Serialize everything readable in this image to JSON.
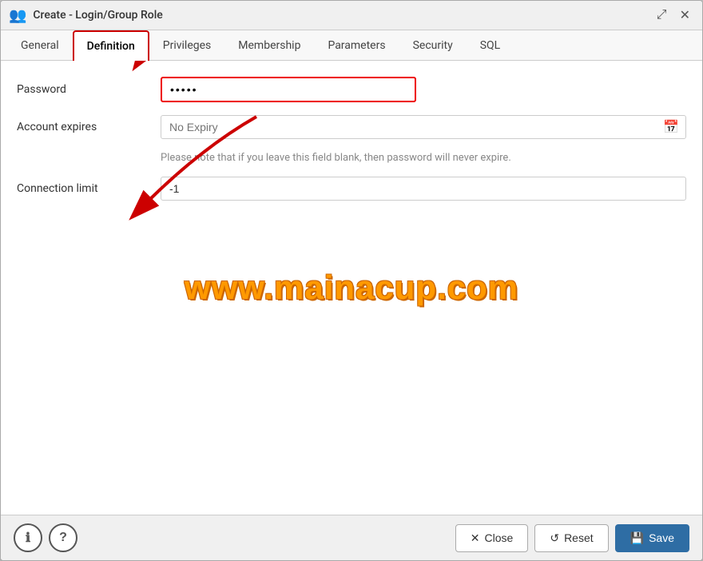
{
  "dialog": {
    "title": "Create - Login/Group Role",
    "maximize_label": "⤢",
    "close_label": "✕"
  },
  "tabs": [
    {
      "id": "general",
      "label": "General",
      "active": false
    },
    {
      "id": "definition",
      "label": "Definition",
      "active": true
    },
    {
      "id": "privileges",
      "label": "Privileges",
      "active": false
    },
    {
      "id": "membership",
      "label": "Membership",
      "active": false
    },
    {
      "id": "parameters",
      "label": "Parameters",
      "active": false
    },
    {
      "id": "security",
      "label": "Security",
      "active": false
    },
    {
      "id": "sql",
      "label": "SQL",
      "active": false
    }
  ],
  "form": {
    "password_label": "Password",
    "password_value": "•••••",
    "account_expires_label": "Account expires",
    "account_expires_placeholder": "No Expiry",
    "account_expires_hint": "Please note that if you leave this field blank, then password will never expire.",
    "connection_limit_label": "Connection limit",
    "connection_limit_value": "-1"
  },
  "footer": {
    "info_icon": "ℹ",
    "help_icon": "?",
    "close_label": "Close",
    "reset_label": "Reset",
    "save_label": "Save"
  },
  "watermark": "www.mainacup.com"
}
